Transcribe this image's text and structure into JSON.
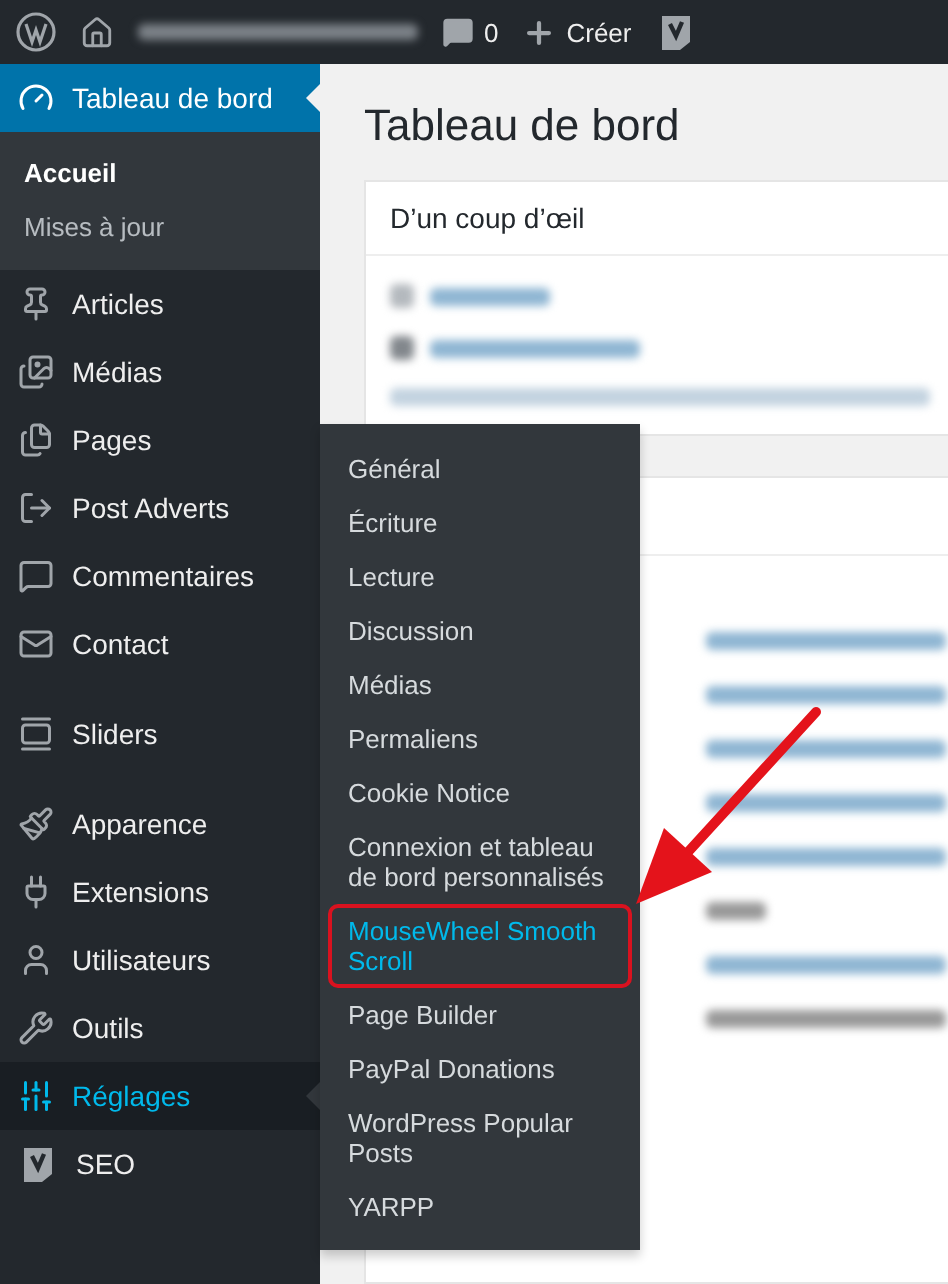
{
  "admin_bar": {
    "comments": "0",
    "create": "Créer"
  },
  "sidebar": {
    "groups": [
      {
        "items": [
          {
            "label": "Tableau de bord",
            "selected": true,
            "children": [
              {
                "label": "Accueil",
                "selected": true
              },
              {
                "label": "Mises à jour",
                "selected": false
              }
            ]
          },
          {
            "label": "Articles",
            "selected": false
          },
          {
            "label": "Médias",
            "selected": false
          },
          {
            "label": "Pages",
            "selected": false
          },
          {
            "label": "Post Adverts",
            "selected": false
          },
          {
            "label": "Commentaires",
            "selected": false
          },
          {
            "label": "Contact",
            "selected": false
          }
        ]
      },
      {
        "items": [
          {
            "label": "Sliders",
            "selected": false
          }
        ]
      },
      {
        "items": [
          {
            "label": "Apparence",
            "selected": false
          },
          {
            "label": "Extensions",
            "selected": false
          },
          {
            "label": "Utilisateurs",
            "selected": false
          },
          {
            "label": "Outils",
            "selected": false
          },
          {
            "label": "Réglages",
            "selected": false,
            "hovered": true
          },
          {
            "label": "SEO",
            "selected": false
          }
        ]
      }
    ]
  },
  "flyout": {
    "items": [
      {
        "label": "Général",
        "selected": false
      },
      {
        "label": "Écriture",
        "selected": false
      },
      {
        "label": "Lecture",
        "selected": false
      },
      {
        "label": "Discussion",
        "selected": false
      },
      {
        "label": "Médias",
        "selected": false
      },
      {
        "label": "Permaliens",
        "selected": false
      },
      {
        "label": "Cookie Notice",
        "selected": false
      },
      {
        "label": "Connexion et tableau de bord personnalisés",
        "selected": false
      },
      {
        "label": "MouseWheel Smooth Scroll",
        "selected": true
      },
      {
        "label": "Page Builder",
        "selected": false
      },
      {
        "label": "PayPal Donations",
        "selected": false
      },
      {
        "label": "WordPress Popular Posts",
        "selected": false
      },
      {
        "label": "YARPP",
        "selected": false
      }
    ]
  },
  "main": {
    "title": "Tableau de bord",
    "card_title": "D’un coup d’œil"
  }
}
